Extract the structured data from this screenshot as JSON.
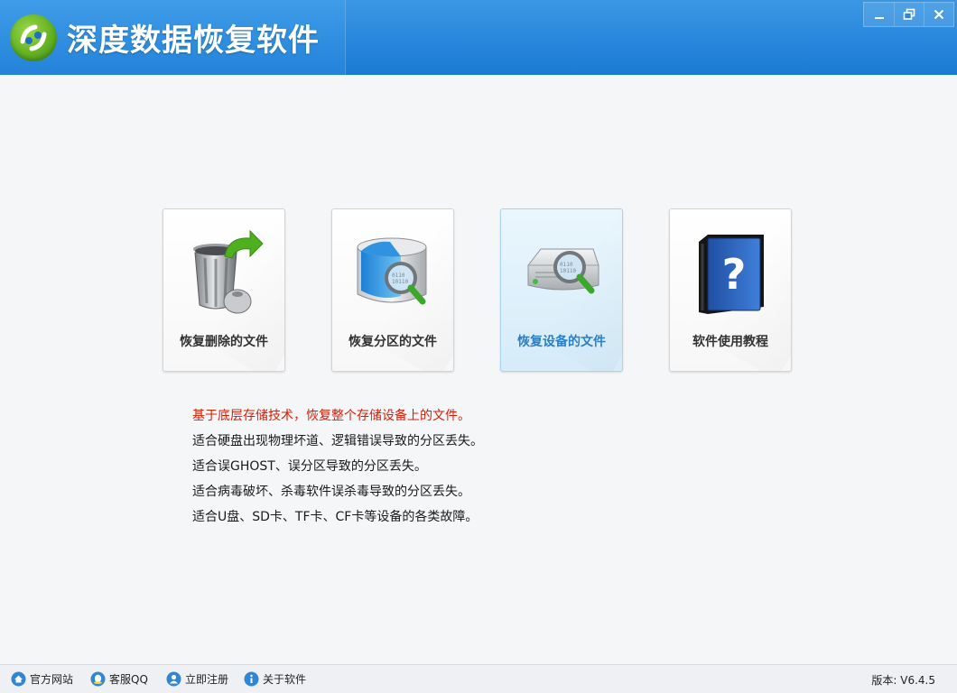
{
  "window": {
    "title": "深度数据恢复软件",
    "buttons": {
      "minimize": "minimize",
      "restore": "restore",
      "close": "close"
    }
  },
  "colors": {
    "titlebar": "#1a7ad4",
    "accent_text": "#2a7fc8",
    "highlight_red": "#d81e06"
  },
  "cards": [
    {
      "label": "恢复删除的文件",
      "icon": "trash-recover-icon",
      "active": false
    },
    {
      "label": "恢复分区的文件",
      "icon": "partition-search-icon",
      "active": false
    },
    {
      "label": "恢复设备的文件",
      "icon": "device-search-icon",
      "active": true
    },
    {
      "label": "软件使用教程",
      "icon": "help-book-icon",
      "active": false
    }
  ],
  "description": {
    "highlight": "基于底层存储技术，恢复整个存储设备上的文件。",
    "lines": [
      "适合硬盘出现物理坏道、逻辑错误导致的分区丢失。",
      "适合误GHOST、误分区导致的分区丢失。",
      "适合病毒破坏、杀毒软件误杀毒导致的分区丢失。",
      "适合U盘、SD卡、TF卡、CF卡等设备的各类故障。"
    ]
  },
  "statusbar": {
    "links": [
      {
        "label": "官方网站",
        "icon": "home-icon"
      },
      {
        "label": "客服QQ",
        "icon": "qq-icon"
      },
      {
        "label": "立即注册",
        "icon": "user-register-icon"
      },
      {
        "label": "关于软件",
        "icon": "info-icon"
      }
    ],
    "version": "版本: V6.4.5"
  }
}
